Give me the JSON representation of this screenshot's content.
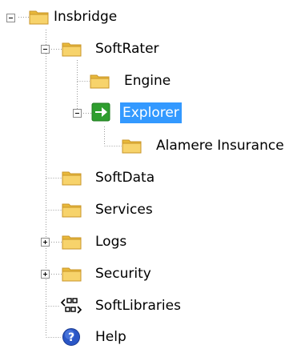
{
  "tree": {
    "nodes": [
      {
        "label": "Insbridge",
        "icon": "folder-icon",
        "expander": "expanded"
      },
      {
        "label": "SoftRater",
        "icon": "folder-icon",
        "expander": "expanded"
      },
      {
        "label": "Engine",
        "icon": "folder-icon",
        "expander": "none"
      },
      {
        "label": "Explorer",
        "icon": "green-arrow-icon",
        "expander": "expanded",
        "selected": true
      },
      {
        "label": "Alamere Insurance",
        "icon": "folder-icon",
        "expander": "none"
      },
      {
        "label": "SoftData",
        "icon": "folder-icon",
        "expander": "none"
      },
      {
        "label": "Services",
        "icon": "folder-icon",
        "expander": "none"
      },
      {
        "label": "Logs",
        "icon": "folder-icon",
        "expander": "collapsed"
      },
      {
        "label": "Security",
        "icon": "folder-icon",
        "expander": "collapsed"
      },
      {
        "label": "SoftLibraries",
        "icon": "library-link-icon",
        "expander": "none"
      },
      {
        "label": "Help",
        "icon": "help-icon",
        "expander": "none"
      }
    ]
  },
  "colors": {
    "selection": "#3399ff",
    "folder": "#f5c542",
    "arrow": "#2e9e2e",
    "help": "#2a56c6"
  }
}
